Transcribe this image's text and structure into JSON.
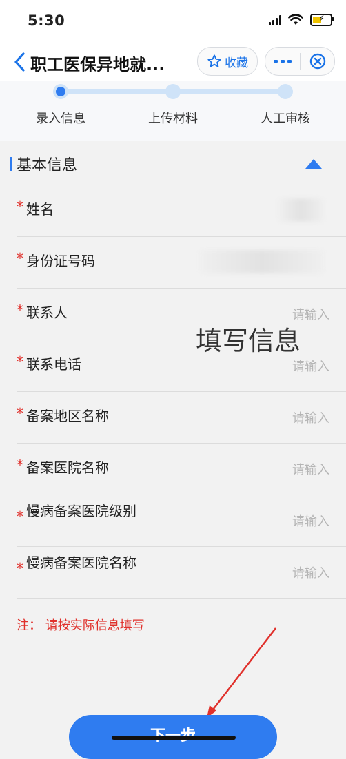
{
  "status_bar": {
    "time": "5:30",
    "icons": [
      "signal-icon",
      "wifi-icon",
      "battery-charging-icon"
    ]
  },
  "header": {
    "title": "职工医保异地就...",
    "favorite_label": "收藏",
    "icons": [
      "back-icon",
      "star-icon",
      "more-icon",
      "close-target-icon"
    ]
  },
  "steps": [
    {
      "label": "录入信息",
      "active": true
    },
    {
      "label": "上传材料",
      "active": false
    },
    {
      "label": "人工审核",
      "active": false
    }
  ],
  "section": {
    "title": "基本信息",
    "collapse_icon": "triangle-up-icon"
  },
  "form": {
    "required_mark": "*",
    "fields": [
      {
        "label": "姓名",
        "placeholder": "",
        "value": ""
      },
      {
        "label": "身份证号码",
        "placeholder": "",
        "value": ""
      },
      {
        "label": "联系人",
        "placeholder": "请输入",
        "value": ""
      },
      {
        "label": "联系电话",
        "placeholder": "请输入",
        "value": ""
      },
      {
        "label": "备案地区名称",
        "placeholder": "请输入",
        "value": ""
      },
      {
        "label": "备案医院名称",
        "placeholder": "请输入",
        "value": ""
      },
      {
        "label": "慢病备案医院级别",
        "placeholder": "请输入",
        "value": ""
      },
      {
        "label": "慢病备案医院名称",
        "placeholder": "请输入",
        "value": ""
      }
    ]
  },
  "note": "注： 请按实际信息填写",
  "overlay_text": "填写信息",
  "next_button": "下一步",
  "colors": {
    "accent": "#2f7cf0",
    "required": "#e0302b",
    "annotation_arrow": "#e0302b"
  }
}
